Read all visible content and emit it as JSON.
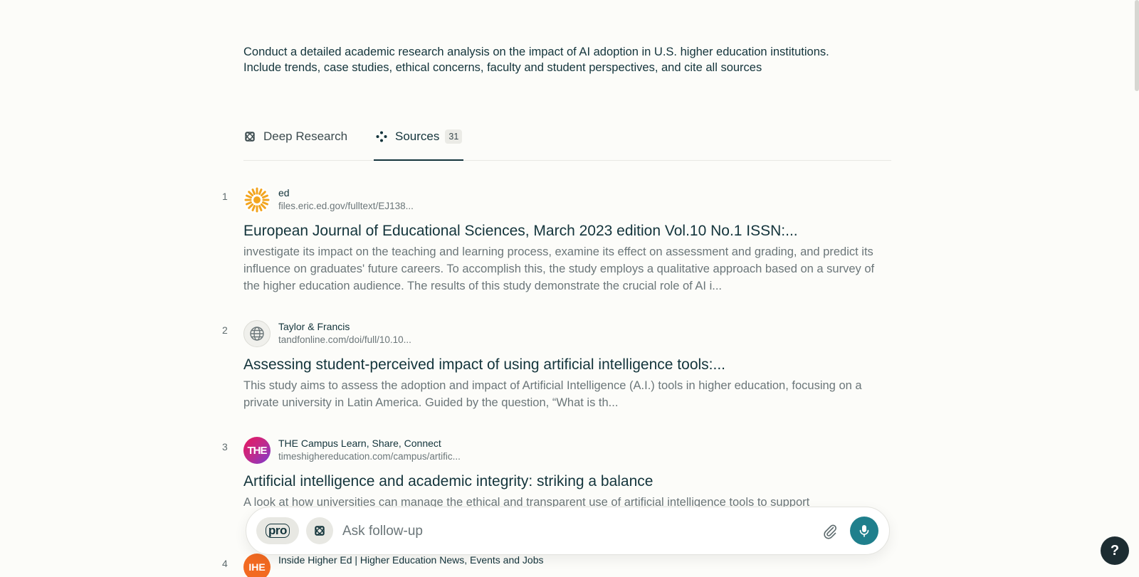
{
  "query": "Conduct a detailed academic research analysis on the impact of AI adoption in U.S. higher education institutions. Include trends, case studies, ethical concerns, faculty and student perspectives, and cite all sources",
  "tabs": {
    "deep_research": "Deep Research",
    "sources": "Sources",
    "sources_count": "31"
  },
  "sources": [
    {
      "num": "1",
      "site": "ed",
      "url": "files.eric.ed.gov/fulltext/EJ138...",
      "title": "European Journal of Educational Sciences, March 2023 edition Vol.10 No.1 ISSN:...",
      "snippet": "investigate its impact on the teaching and learning process, examine its effect on assessment and grading, and predict its influence on graduates' future careers. To accomplish this, the study employs a qualitative approach based on a survey of the higher education audience. The results of this study demonstrate the crucial role of AI i...",
      "icon": "eric-sun-icon"
    },
    {
      "num": "2",
      "site": "Taylor & Francis",
      "url": "tandfonline.com/doi/full/10.10...",
      "title": "Assessing student-perceived impact of using artificial intelligence tools:...",
      "snippet": "This study aims to assess the adoption and impact of Artificial Intelligence (A.I.) tools in higher education, focusing on a private university in Latin America. Guided by the question, “What is th...",
      "icon": "globe-icon"
    },
    {
      "num": "3",
      "site": "THE Campus Learn, Share, Connect",
      "url": "timeshighereducation.com/campus/artific...",
      "title": "Artificial intelligence and academic integrity: striking a balance",
      "snippet": "A look at how universities can manage the ethical and transparent use of artificial intelligence tools to support",
      "icon": "the-logo-icon",
      "logo_text": "THE"
    },
    {
      "num": "4",
      "site": "Inside Higher Ed | Higher Education News, Events and Jobs",
      "icon": "ihe-logo-icon",
      "logo_text": "IHE"
    }
  ],
  "followup": {
    "placeholder": "Ask follow-up",
    "pro_label": "pro"
  },
  "help_label": "?",
  "colors": {
    "background": "#fcfcf9",
    "text": "#13343b",
    "muted": "#6b7679",
    "accent": "#1f7f8c",
    "help_bg": "#1d2d32"
  }
}
